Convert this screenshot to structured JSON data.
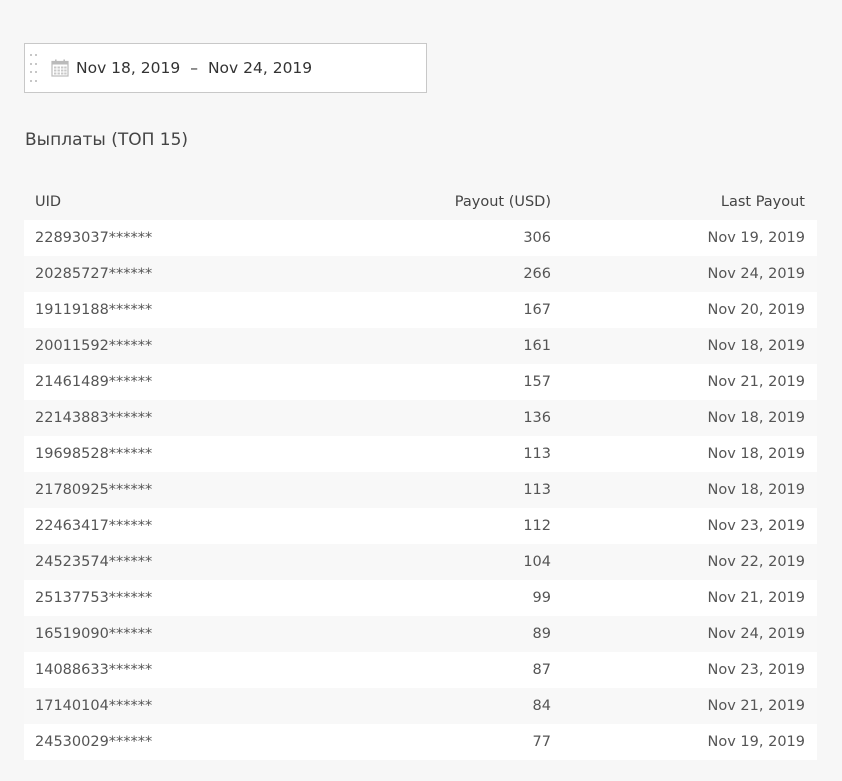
{
  "date_picker": {
    "start": "Nov 18, 2019",
    "separator": "–",
    "end": "Nov 24, 2019",
    "icon": "calendar-icon"
  },
  "section_title": "Выплаты (ТОП 15)",
  "table": {
    "headers": {
      "uid": "UID",
      "payout": "Payout (USD)",
      "last": "Last Payout"
    },
    "rows": [
      {
        "uid": "22893037******",
        "payout": "306",
        "last": "Nov 19, 2019"
      },
      {
        "uid": "20285727******",
        "payout": "266",
        "last": "Nov 24, 2019"
      },
      {
        "uid": "19119188******",
        "payout": "167",
        "last": "Nov 20, 2019"
      },
      {
        "uid": "20011592******",
        "payout": "161",
        "last": "Nov 18, 2019"
      },
      {
        "uid": "21461489******",
        "payout": "157",
        "last": "Nov 21, 2019"
      },
      {
        "uid": "22143883******",
        "payout": "136",
        "last": "Nov 18, 2019"
      },
      {
        "uid": "19698528******",
        "payout": "113",
        "last": "Nov 18, 2019"
      },
      {
        "uid": "21780925******",
        "payout": "113",
        "last": "Nov 18, 2019"
      },
      {
        "uid": "22463417******",
        "payout": "112",
        "last": "Nov 23, 2019"
      },
      {
        "uid": "24523574******",
        "payout": "104",
        "last": "Nov 22, 2019"
      },
      {
        "uid": "25137753******",
        "payout": "99",
        "last": "Nov 21, 2019"
      },
      {
        "uid": "16519090******",
        "payout": "89",
        "last": "Nov 24, 2019"
      },
      {
        "uid": "14088633******",
        "payout": "87",
        "last": "Nov 23, 2019"
      },
      {
        "uid": "17140104******",
        "payout": "84",
        "last": "Nov 21, 2019"
      },
      {
        "uid": "24530029******",
        "payout": "77",
        "last": "Nov 19, 2019"
      }
    ]
  }
}
